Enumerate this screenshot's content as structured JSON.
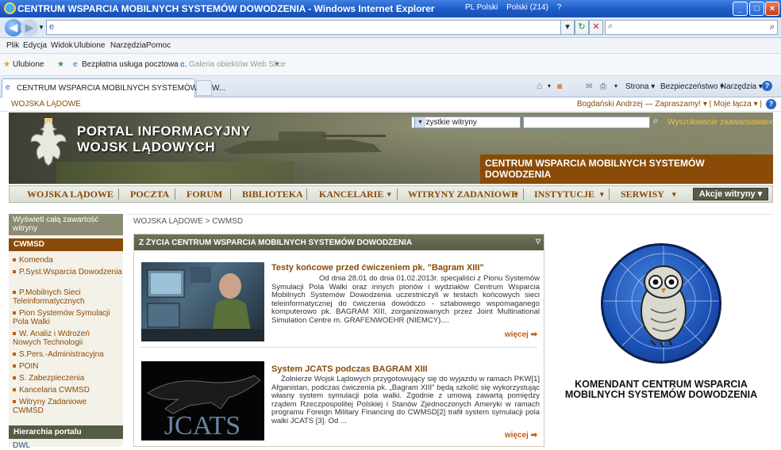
{
  "browser": {
    "window_title": "CENTRUM WSPARCIA MOBILNYCH SYSTEMÓW DOWODZENIA - Windows Internet Explorer",
    "lang_indicator": "PL Polski",
    "keyboard_indicator": "Polski (214)",
    "address_value": "",
    "search_placeholder": "",
    "menu": [
      "Plik",
      "Edycja",
      "Widok",
      "Ulubione",
      "Narzędzia",
      "Pomoc"
    ],
    "favorites_label": "Ulubione",
    "favorites": [
      "Bezpłatna usługa pocztowa ...",
      "Galeria obiektów Web Slice"
    ],
    "tab_title": "CENTRUM WSPARCIA MOBILNYCH SYSTEMÓW DOW...",
    "commands": [
      "Strona",
      "Bezpieczeństwo",
      "Narzędzia"
    ]
  },
  "page": {
    "site_link": "WOJSKA LĄDOWE",
    "user_bar": "Bogdański Andrzej — Zapraszamy! ▾ | Moje łącza ▾ |",
    "banner": {
      "title_line1": "PORTAL INFORMACYJNY",
      "title_line2": "WOJSK LĄDOWYCH",
      "scope_select": "Wszystkie witryny",
      "search_value": "",
      "advanced_search": "Wyszukiwanie zaawansowane",
      "site_name": "CENTRUM WSPARCIA MOBILNYCH SYSTEMÓW DOWODZENIA"
    },
    "nav": {
      "items": [
        "WOJSKA LĄDOWE",
        "POCZTA",
        "FORUM",
        "BIBLIOTEKA",
        "KANCELARIE",
        "WITRYNY ZADANIOWE",
        "INSTYTUCJE",
        "SERWISY"
      ],
      "site_actions": "Akcje witryny"
    },
    "leftnav": {
      "show_all": "Wyświetl całą zawartość witryny",
      "section": "CWMSD",
      "items": [
        "Komenda",
        "P.Syst.Wsparcia Dowodzenia",
        "P.Mobilnych Sieci Teleinformatycznych",
        "Pion Systemów Symulacji Pola Walki",
        "W. Analiz i Wdrożeń Nowych Technologii",
        "S.Pers.-Administracyjna",
        "POIN",
        "S. Zabezpieczenia",
        "Kancelaria CWMSD",
        "Witryny Zadaniowe CWMSD"
      ],
      "hierarchy_head": "Hierarchia portalu",
      "hierarchy_item": "DWL"
    },
    "breadcrumb": "WOJSKA LĄDOWE > CWMSD",
    "news": {
      "header": "Z ŻYCIA CENTRUM WSPARCIA MOBILNYCH SYSTEMÓW DOWODZENIA",
      "items": [
        {
          "title": "Testy końcowe przed ćwiczeniem pk. \"Bagram XIII\"",
          "body": "Od dnia 28.01 do dnia 01.02.2013r. specjaliści z Pionu Systemów Symulacji Pola Walki oraz innych pionów i wydziałów Centrum Wsparcia Mobilnych Systemów Dowodzenia uczestniczyli w testach końcowych sieci teleinformatycznej do ćwiczenia dowódczo - sztabowego wspomaganego komputerowo pk. BAGRAM XIII, zorganizowanych przez Joint Multinational Simulation Centre m. GRAFENWOEHR (NIEMCY)....",
          "more": "więcej"
        },
        {
          "title": "System JCATS podczas BAGRAM XIII",
          "body": "Żołnierze Wojsk Lądowych przygotowujący się do wyjazdu w ramach PKW[1] Afganistan, podczas ćwiczenia pk. „Bagram XIII” będą szkolić się wykorzystując własny system symulacji pola walki. Zgodnie z umową zawartą pomiędzy rządem Rzeczpospolitej Polskiej i Stanów Zjednoczonych Ameryki w ramach programu Foreign Military Financing do CWMSD[2] trafił system symulacji pola walki JCATS [3]. Od ...",
          "more": "więcej",
          "image_text": "JCATS"
        }
      ]
    },
    "commander": "KOMENDANT CENTRUM WSPARCIA MOBILNYCH SYSTEMÓW DOWODZENIA"
  }
}
